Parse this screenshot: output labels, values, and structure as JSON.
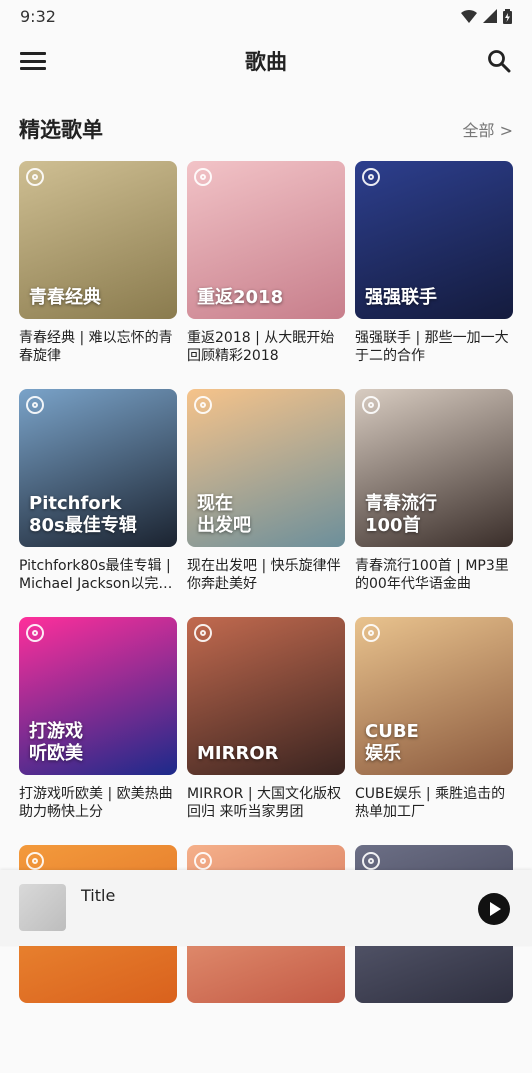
{
  "status": {
    "time": "9:32"
  },
  "appbar": {
    "title": "歌曲"
  },
  "section": {
    "title": "精选歌单",
    "more": "全部 >"
  },
  "playlists": [
    {
      "cover_text": "青春经典",
      "caption": "青春经典 | 难以忘怀的青春旋律",
      "colors": [
        "#cfbf93",
        "#8a7b4e"
      ]
    },
    {
      "cover_text": "重返2018",
      "caption": "重返2018 | 从大眠开始回顾精彩2018",
      "colors": [
        "#f2c3c7",
        "#c77e8b"
      ]
    },
    {
      "cover_text": "强强联手",
      "caption": "强强联手 | 那些一加一大于二的合作",
      "colors": [
        "#2d3f8e",
        "#141b3d"
      ]
    },
    {
      "cover_text": "Pitchfork\n80s最佳专辑",
      "caption": "Pitchfork80s最佳专辑 | Michael Jackson以完…",
      "colors": [
        "#7aa3c9",
        "#1b2330"
      ]
    },
    {
      "cover_text": "现在\n出发吧",
      "caption": "现在出发吧 | 快乐旋律伴你奔赴美好",
      "colors": [
        "#f6c38a",
        "#6c8f9b"
      ]
    },
    {
      "cover_text": "青春流行\n100首",
      "caption": "青春流行100首 | MP3里的00年代华语金曲",
      "colors": [
        "#d8ccc1",
        "#3a2e2a"
      ]
    },
    {
      "cover_text": "打游戏\n听欧美",
      "caption": "打游戏听欧美 | 欧美热曲助力畅快上分",
      "colors": [
        "#ff2f9b",
        "#1c2a8a"
      ]
    },
    {
      "cover_text": "MIRROR",
      "caption": "MIRROR | 大国文化版权回归 来听当家男团",
      "colors": [
        "#c26a4f",
        "#3a2420"
      ]
    },
    {
      "cover_text": "CUBE\n娱乐",
      "caption": "CUBE娱乐 | 乘胜追击的热单加工厂",
      "colors": [
        "#e9c38e",
        "#8b5a3e"
      ]
    },
    {
      "cover_text": "",
      "caption": "",
      "colors": [
        "#f39a3c",
        "#d9611d"
      ]
    },
    {
      "cover_text": "",
      "caption": "",
      "colors": [
        "#f5b08a",
        "#c35a45"
      ]
    },
    {
      "cover_text": "",
      "caption": "",
      "colors": [
        "#6c6f86",
        "#2e2f3f"
      ]
    }
  ],
  "player": {
    "title": "Title"
  },
  "icons": {
    "menu": "menu-icon",
    "search": "search-icon",
    "play": "play-icon",
    "wifi": "wifi-icon",
    "signal": "signal-icon",
    "battery": "battery-icon",
    "badge": "netease-logo-icon"
  }
}
